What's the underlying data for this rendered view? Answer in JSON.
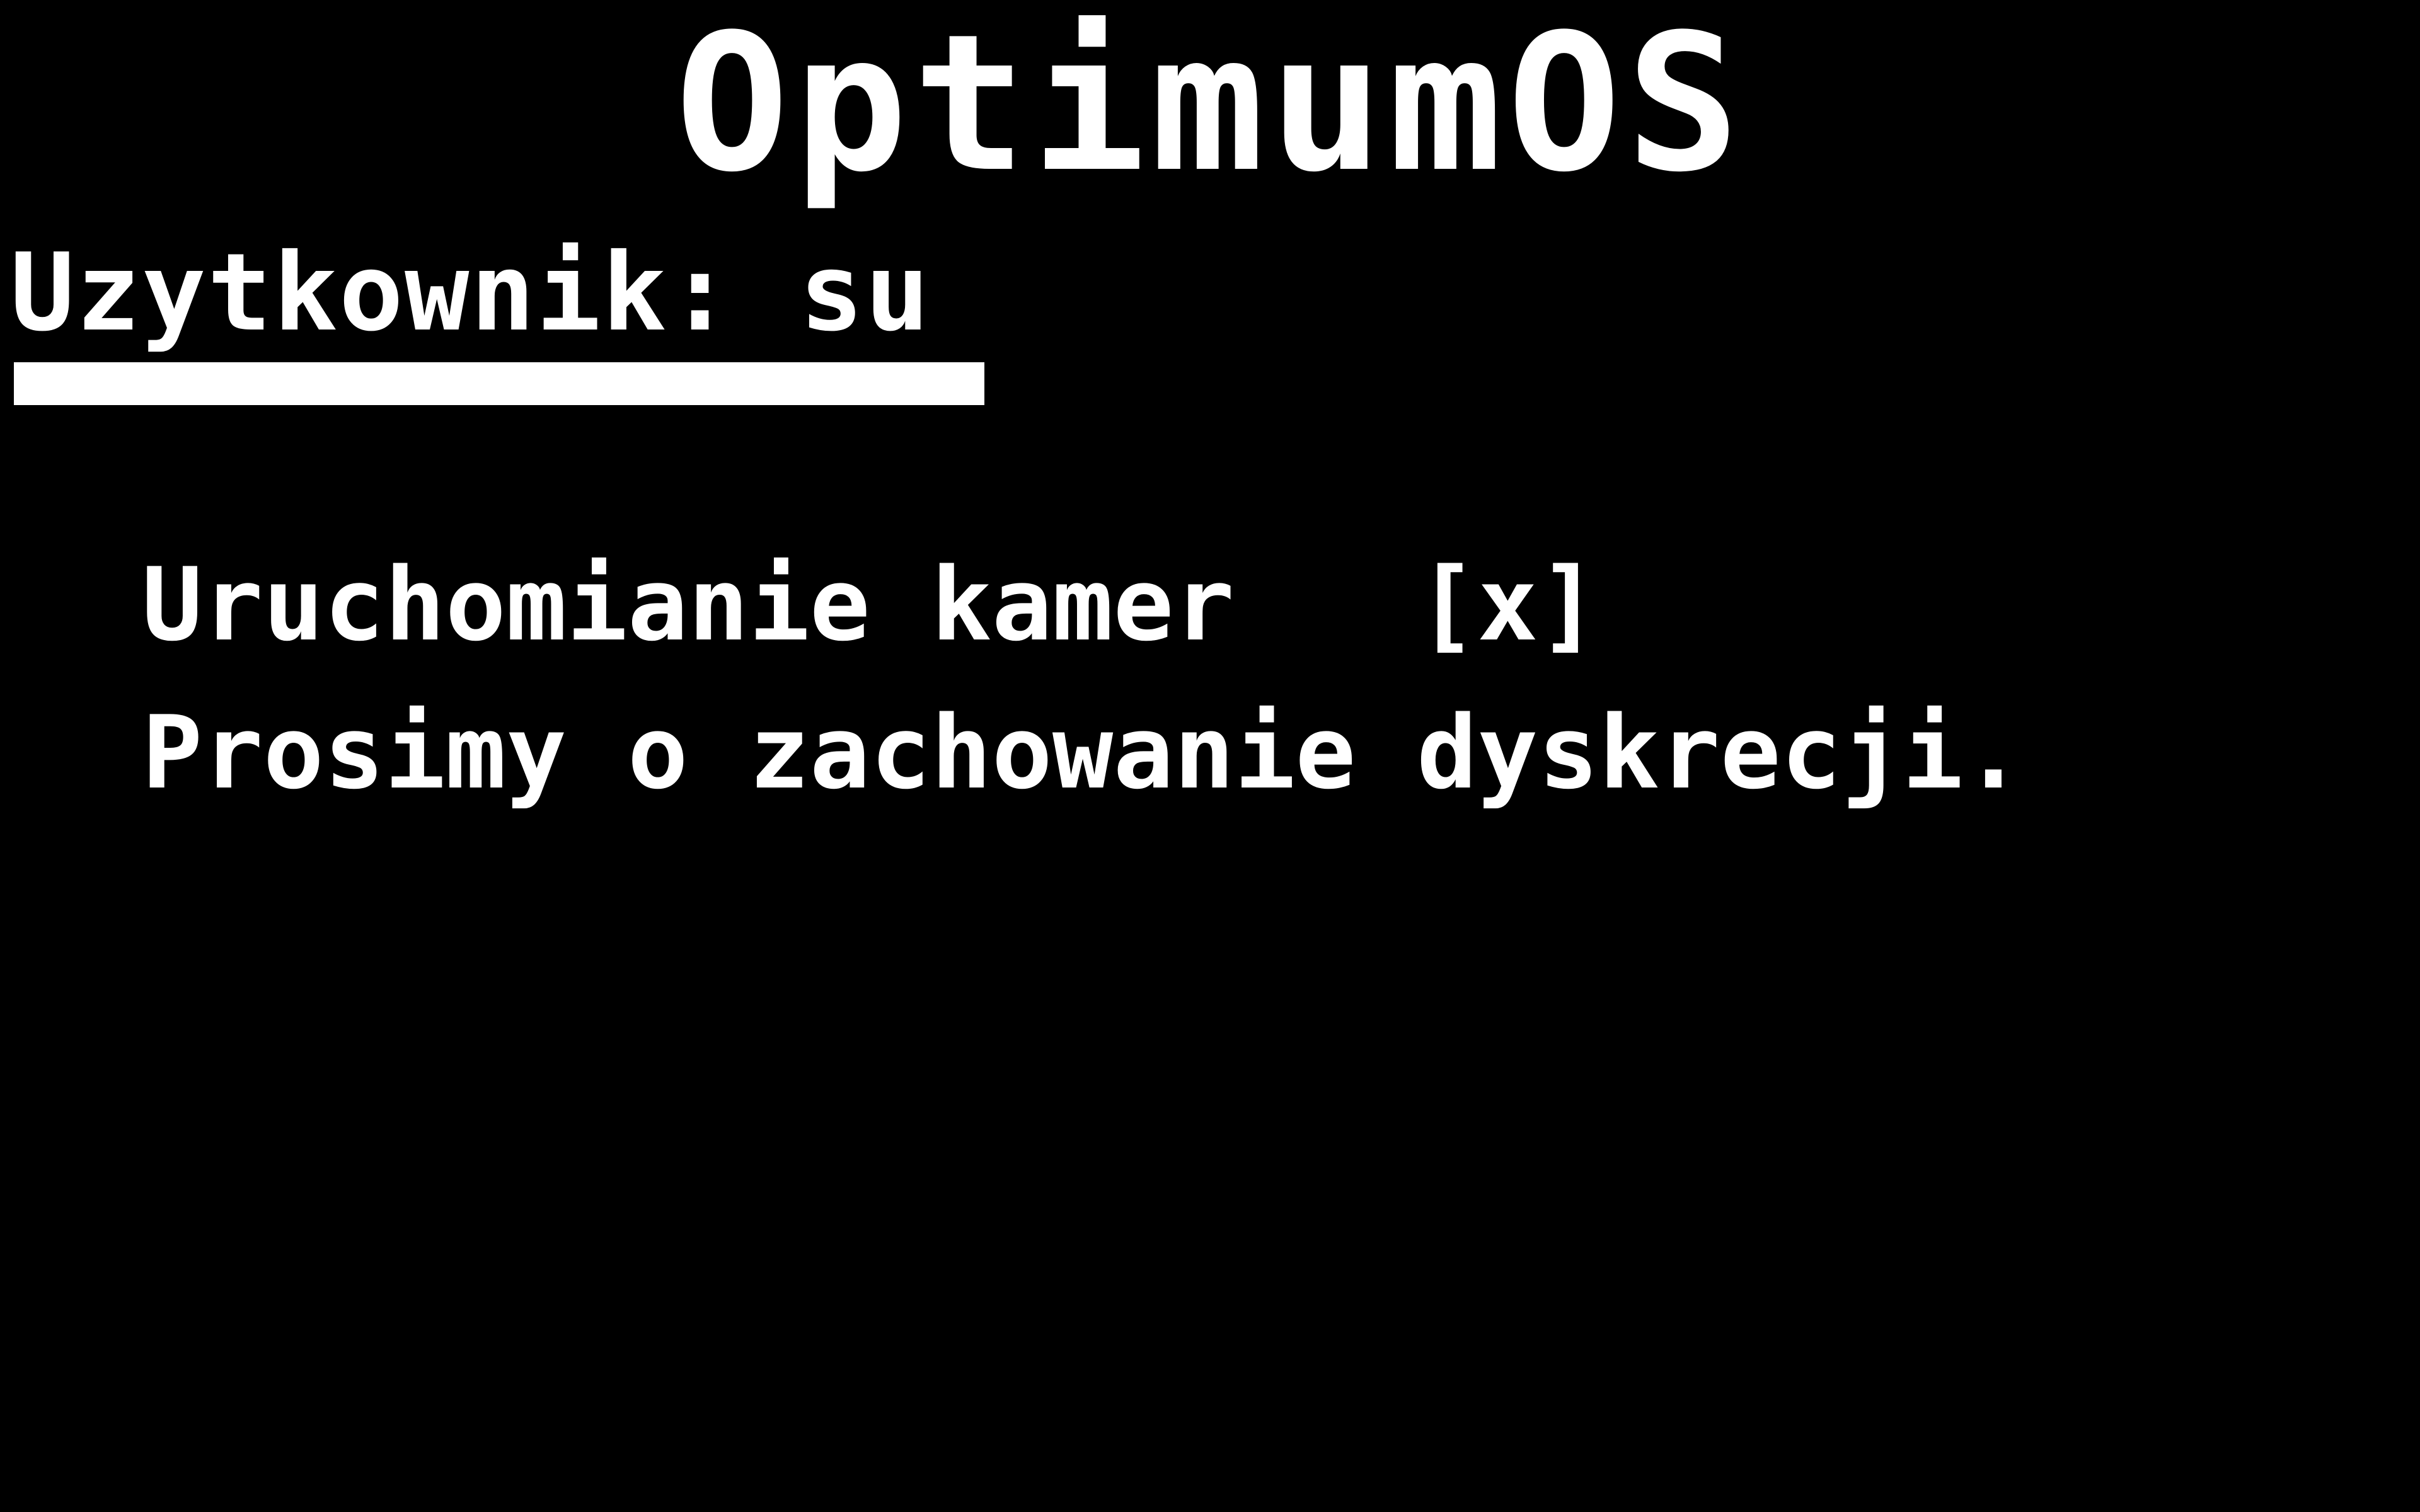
{
  "screen": {
    "title": "OptimumOS",
    "user_line": "Uzytkownik: su",
    "progress": 1.0,
    "status": {
      "label": "Uruchomianie kamer",
      "checkbox": "[x]"
    },
    "notice": "Prosimy o zachowanie dyskrecji."
  },
  "colors": {
    "background": "#000000",
    "foreground": "#ffffff"
  }
}
